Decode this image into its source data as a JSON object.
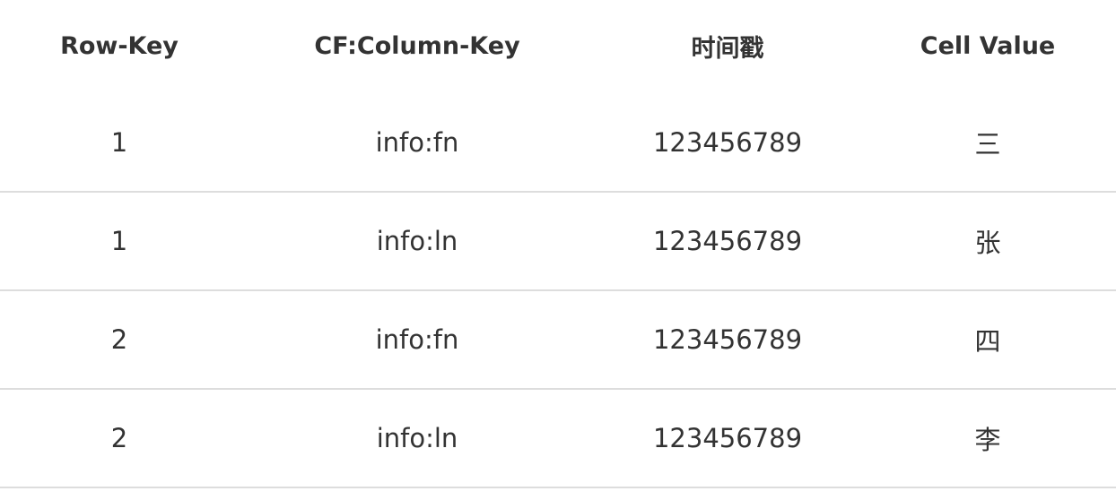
{
  "table": {
    "headers": [
      "Row-Key",
      "CF:Column-Key",
      "时间戳",
      "Cell Value"
    ],
    "rows": [
      [
        "1",
        "info:fn",
        "123456789",
        "三"
      ],
      [
        "1",
        "info:ln",
        "123456789",
        "张"
      ],
      [
        "2",
        "info:fn",
        "123456789",
        "四"
      ],
      [
        "2",
        "info:ln",
        "123456789",
        "李"
      ]
    ]
  }
}
